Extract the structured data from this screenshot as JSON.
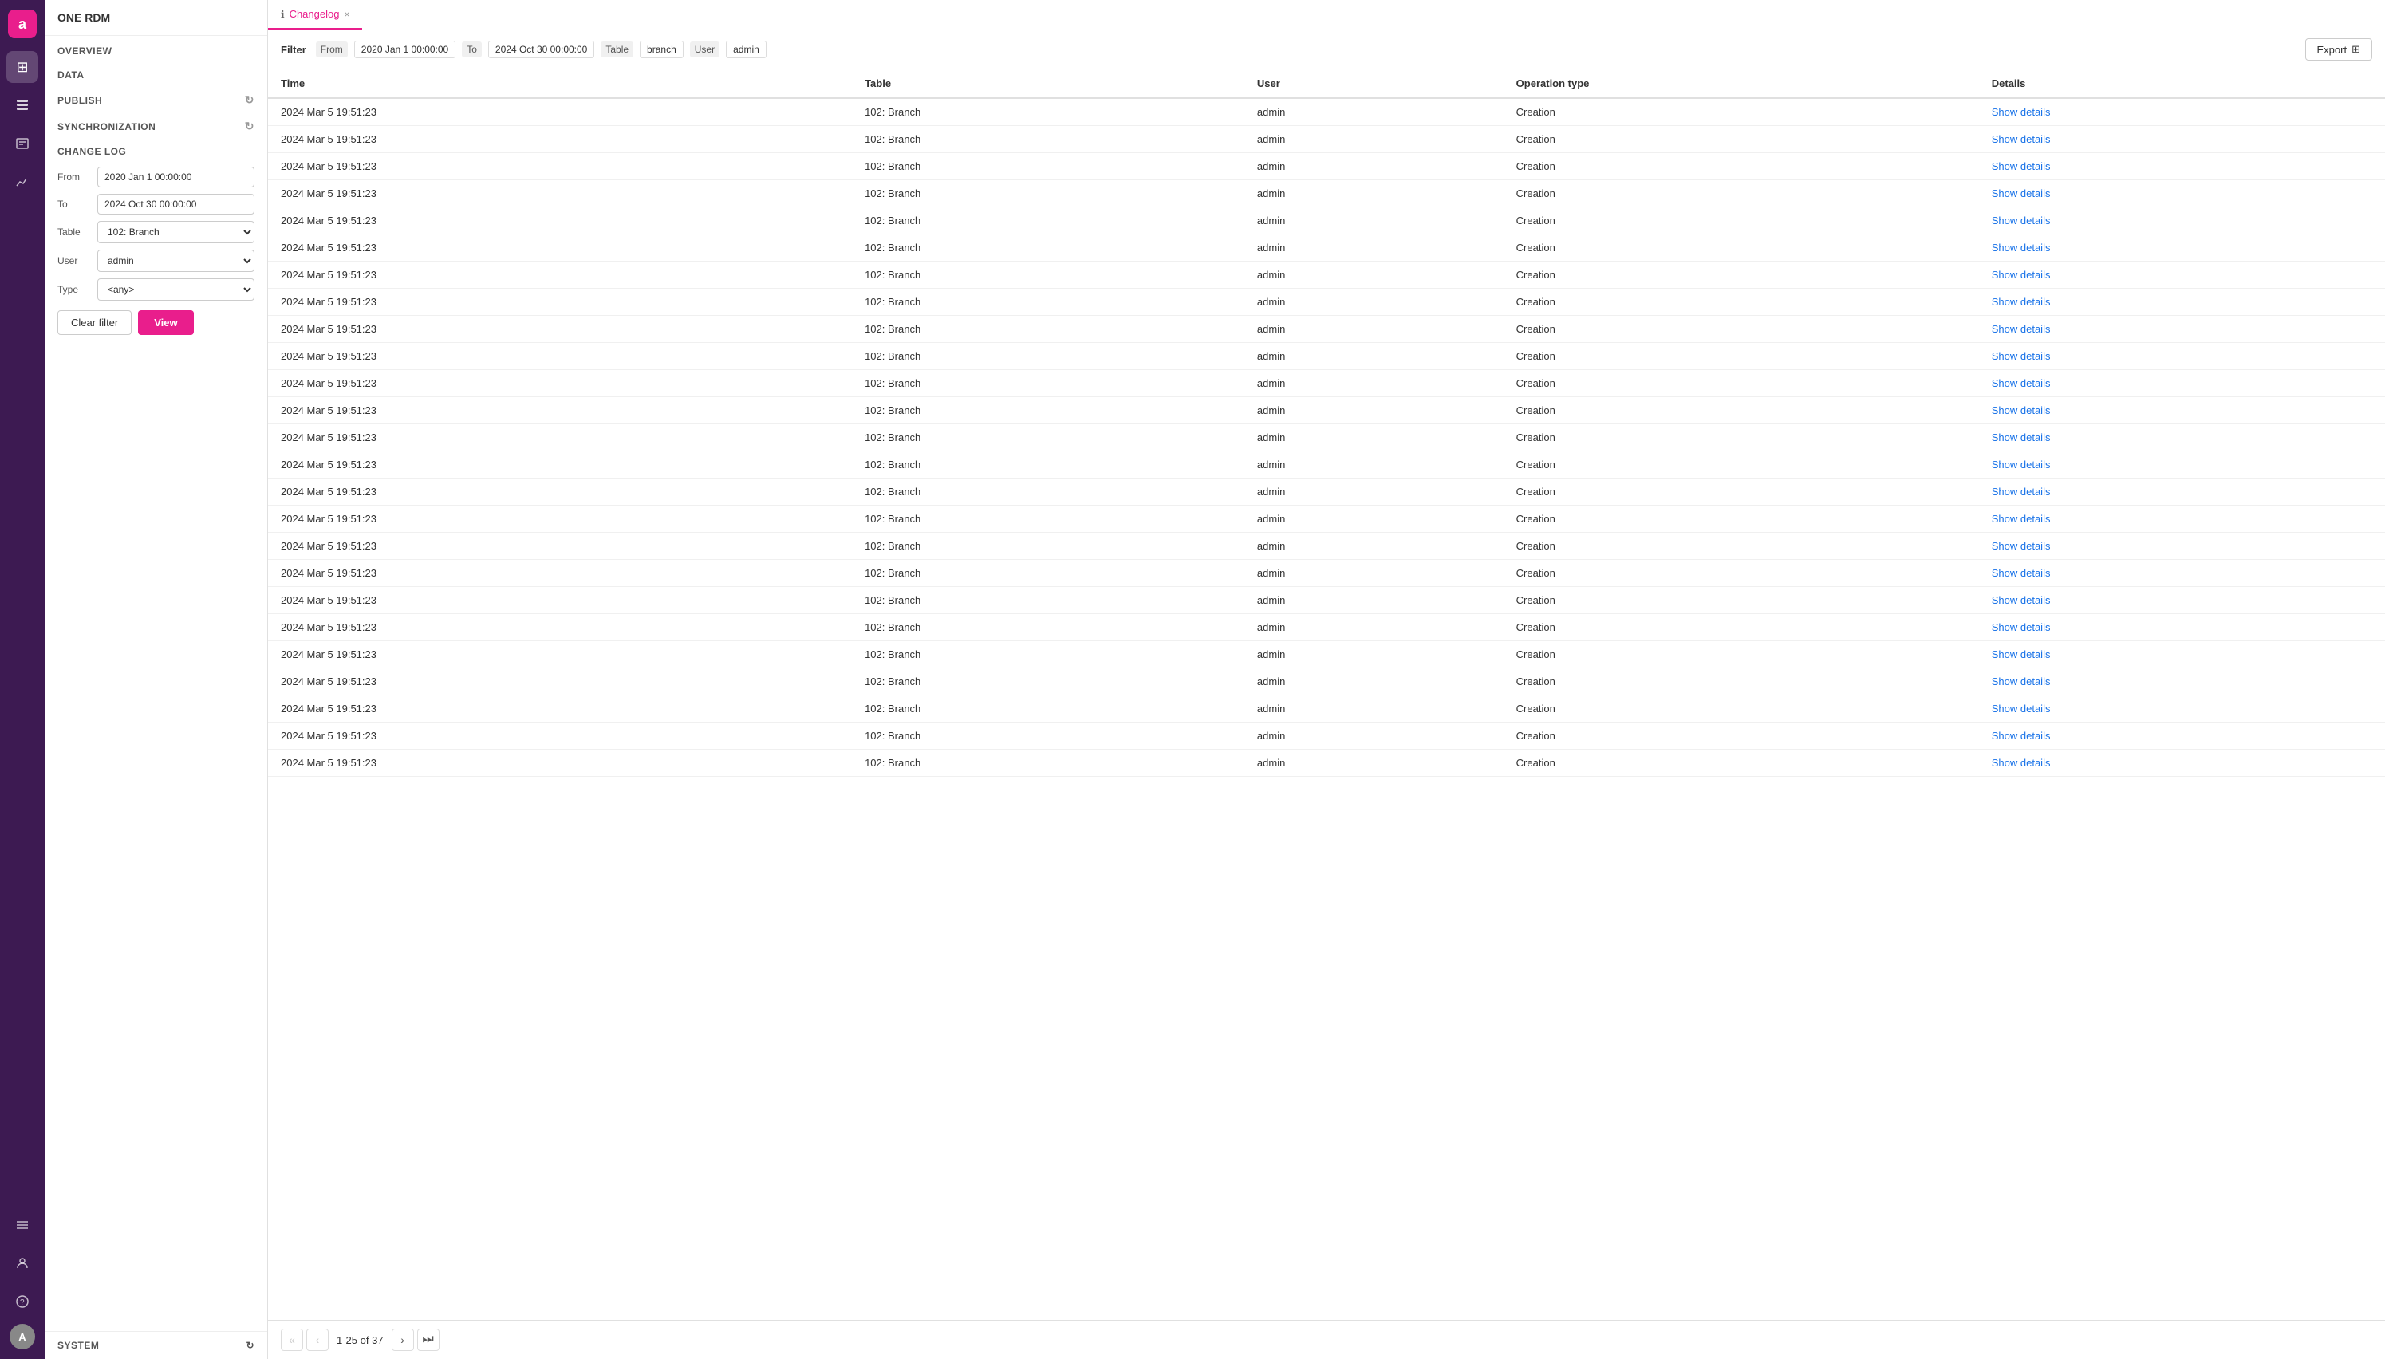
{
  "app": {
    "logo": "a",
    "brand": "ONE RDM"
  },
  "icon_bar": {
    "icons": [
      {
        "name": "overview-icon",
        "symbol": "⊞",
        "active": false
      },
      {
        "name": "data-icon",
        "symbol": "📋",
        "active": true
      },
      {
        "name": "publish-icon",
        "symbol": "📖",
        "active": false
      },
      {
        "name": "chart-icon",
        "symbol": "📊",
        "active": false
      },
      {
        "name": "settings-icon",
        "symbol": "≡",
        "active": false
      },
      {
        "name": "user-icon",
        "symbol": "👤",
        "active": false
      },
      {
        "name": "help-icon",
        "symbol": "?",
        "active": false
      }
    ],
    "avatar_label": "A"
  },
  "sidebar": {
    "brand": "ONE RDM",
    "sections": [
      {
        "label": "OVERVIEW",
        "has_refresh": false
      },
      {
        "label": "DATA",
        "has_refresh": false
      },
      {
        "label": "PUBLISH",
        "has_refresh": true
      },
      {
        "label": "SYNCHRONIZATION",
        "has_refresh": true
      }
    ],
    "changelog": {
      "title": "CHANGE LOG",
      "filters": {
        "from_label": "From",
        "from_value": "2020 Jan 1 00:00:00",
        "to_label": "To",
        "to_value": "2024 Oct 30 00:00:00",
        "table_label": "Table",
        "table_value": "102: Branch",
        "user_label": "User",
        "user_value": "admin",
        "type_label": "Type",
        "type_value": "<any>"
      },
      "clear_filter_label": "Clear filter",
      "view_label": "View"
    },
    "system_label": "SYSTEM"
  },
  "tab": {
    "icon": "ℹ",
    "label": "Changelog",
    "close": "×"
  },
  "filter_bar": {
    "label": "Filter",
    "from_label": "From",
    "from_value": "2020 Jan 1 00:00:00",
    "to_label": "To",
    "to_value": "2024 Oct 30 00:00:00",
    "table_label": "Table",
    "table_value": "branch",
    "user_label": "User",
    "user_value": "admin",
    "export_label": "Export",
    "columns_icon": "⊞"
  },
  "table": {
    "columns": [
      "Time",
      "Table",
      "User",
      "Operation type",
      "Details"
    ],
    "rows": [
      {
        "time": "2024 Mar 5 19:51:23",
        "table": "102: Branch",
        "user": "admin",
        "op": "Creation",
        "details": "Show details"
      },
      {
        "time": "2024 Mar 5 19:51:23",
        "table": "102: Branch",
        "user": "admin",
        "op": "Creation",
        "details": "Show details"
      },
      {
        "time": "2024 Mar 5 19:51:23",
        "table": "102: Branch",
        "user": "admin",
        "op": "Creation",
        "details": "Show details"
      },
      {
        "time": "2024 Mar 5 19:51:23",
        "table": "102: Branch",
        "user": "admin",
        "op": "Creation",
        "details": "Show details"
      },
      {
        "time": "2024 Mar 5 19:51:23",
        "table": "102: Branch",
        "user": "admin",
        "op": "Creation",
        "details": "Show details"
      },
      {
        "time": "2024 Mar 5 19:51:23",
        "table": "102: Branch",
        "user": "admin",
        "op": "Creation",
        "details": "Show details"
      },
      {
        "time": "2024 Mar 5 19:51:23",
        "table": "102: Branch",
        "user": "admin",
        "op": "Creation",
        "details": "Show details"
      },
      {
        "time": "2024 Mar 5 19:51:23",
        "table": "102: Branch",
        "user": "admin",
        "op": "Creation",
        "details": "Show details"
      },
      {
        "time": "2024 Mar 5 19:51:23",
        "table": "102: Branch",
        "user": "admin",
        "op": "Creation",
        "details": "Show details"
      },
      {
        "time": "2024 Mar 5 19:51:23",
        "table": "102: Branch",
        "user": "admin",
        "op": "Creation",
        "details": "Show details"
      },
      {
        "time": "2024 Mar 5 19:51:23",
        "table": "102: Branch",
        "user": "admin",
        "op": "Creation",
        "details": "Show details"
      },
      {
        "time": "2024 Mar 5 19:51:23",
        "table": "102: Branch",
        "user": "admin",
        "op": "Creation",
        "details": "Show details"
      },
      {
        "time": "2024 Mar 5 19:51:23",
        "table": "102: Branch",
        "user": "admin",
        "op": "Creation",
        "details": "Show details"
      },
      {
        "time": "2024 Mar 5 19:51:23",
        "table": "102: Branch",
        "user": "admin",
        "op": "Creation",
        "details": "Show details"
      },
      {
        "time": "2024 Mar 5 19:51:23",
        "table": "102: Branch",
        "user": "admin",
        "op": "Creation",
        "details": "Show details"
      },
      {
        "time": "2024 Mar 5 19:51:23",
        "table": "102: Branch",
        "user": "admin",
        "op": "Creation",
        "details": "Show details"
      },
      {
        "time": "2024 Mar 5 19:51:23",
        "table": "102: Branch",
        "user": "admin",
        "op": "Creation",
        "details": "Show details"
      },
      {
        "time": "2024 Mar 5 19:51:23",
        "table": "102: Branch",
        "user": "admin",
        "op": "Creation",
        "details": "Show details"
      },
      {
        "time": "2024 Mar 5 19:51:23",
        "table": "102: Branch",
        "user": "admin",
        "op": "Creation",
        "details": "Show details"
      },
      {
        "time": "2024 Mar 5 19:51:23",
        "table": "102: Branch",
        "user": "admin",
        "op": "Creation",
        "details": "Show details"
      },
      {
        "time": "2024 Mar 5 19:51:23",
        "table": "102: Branch",
        "user": "admin",
        "op": "Creation",
        "details": "Show details"
      },
      {
        "time": "2024 Mar 5 19:51:23",
        "table": "102: Branch",
        "user": "admin",
        "op": "Creation",
        "details": "Show details"
      },
      {
        "time": "2024 Mar 5 19:51:23",
        "table": "102: Branch",
        "user": "admin",
        "op": "Creation",
        "details": "Show details"
      },
      {
        "time": "2024 Mar 5 19:51:23",
        "table": "102: Branch",
        "user": "admin",
        "op": "Creation",
        "details": "Show details"
      },
      {
        "time": "2024 Mar 5 19:51:23",
        "table": "102: Branch",
        "user": "admin",
        "op": "Creation",
        "details": "Show details"
      }
    ]
  },
  "pagination": {
    "info": "1-25 of 37",
    "first_icon": "«",
    "prev_icon": "‹",
    "next_icon": "›",
    "last_icon": "⏭"
  }
}
